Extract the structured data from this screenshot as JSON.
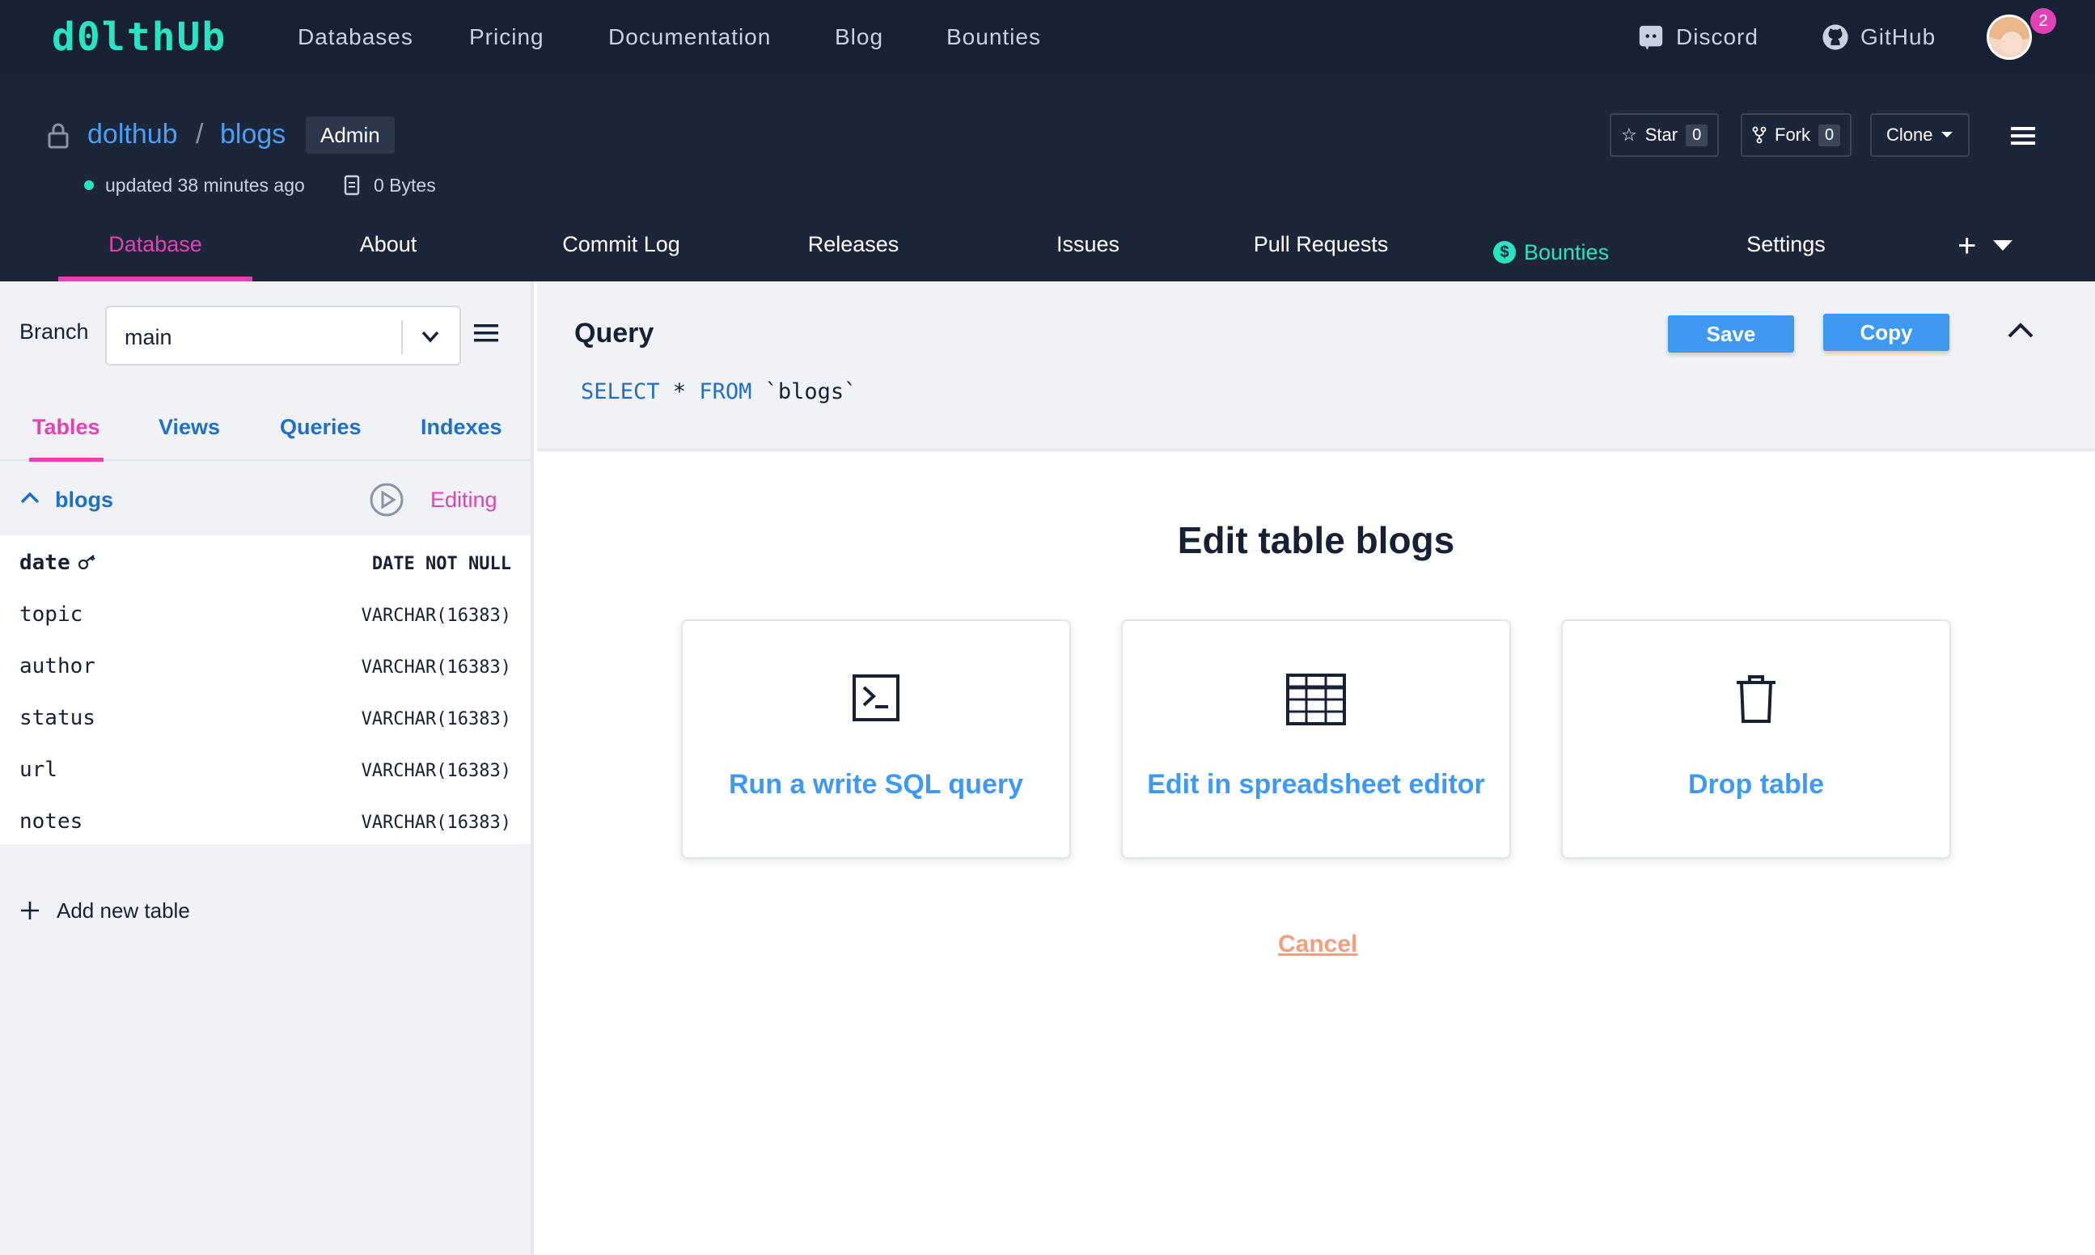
{
  "brand": {
    "logo_text": "d0lthUb",
    "accent": "#29e3c1",
    "pink": "#e043b5",
    "link_blue": "#4a9ef3"
  },
  "topnav": {
    "links": [
      "Databases",
      "Pricing",
      "Documentation",
      "Blog",
      "Bounties"
    ],
    "discord_label": "Discord",
    "github_label": "GitHub",
    "notification_count": "2"
  },
  "repo": {
    "owner": "dolthub",
    "separator": "/",
    "name": "blogs",
    "badge": "Admin",
    "updated": "updated 38 minutes ago",
    "size": "0 Bytes",
    "star_label": "Star",
    "star_count": "0",
    "fork_label": "Fork",
    "fork_count": "0",
    "clone_label": "Clone"
  },
  "tabs": [
    "Database",
    "About",
    "Commit Log",
    "Releases",
    "Issues",
    "Pull Requests",
    "Bounties",
    "Settings"
  ],
  "tabs_plus": "+",
  "bounty_symbol": "$",
  "sidebar": {
    "branch_label": "Branch",
    "branch_value": "main",
    "subtabs": [
      "Tables",
      "Views",
      "Queries",
      "Indexes"
    ],
    "table_name": "blogs",
    "editing_label": "Editing",
    "columns": [
      {
        "name": "date",
        "type": "DATE NOT NULL"
      },
      {
        "name": "topic",
        "type": "VARCHAR(16383)"
      },
      {
        "name": "author",
        "type": "VARCHAR(16383)"
      },
      {
        "name": "status",
        "type": "VARCHAR(16383)"
      },
      {
        "name": "url",
        "type": "VARCHAR(16383)"
      },
      {
        "name": "notes",
        "type": "VARCHAR(16383)"
      }
    ],
    "add_table_label": "Add new table"
  },
  "query": {
    "title": "Query",
    "sql_select": "SELECT",
    "sql_star": " * ",
    "sql_from": "FROM",
    "sql_table": " `blogs`",
    "save_label": "Save",
    "copy_label": "Copy"
  },
  "edit": {
    "title": "Edit table blogs",
    "cards": [
      "Run a write SQL query",
      "Edit in spreadsheet editor",
      "Drop table"
    ],
    "cancel_label": "Cancel"
  }
}
